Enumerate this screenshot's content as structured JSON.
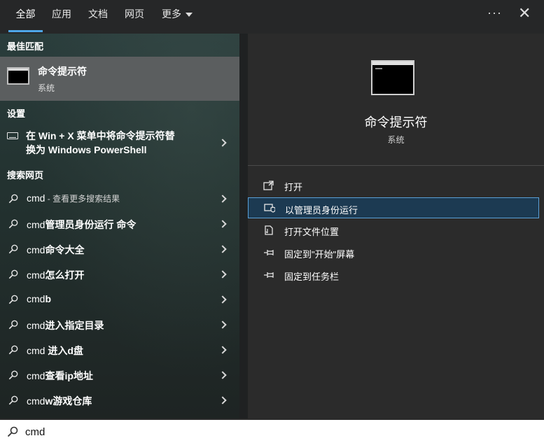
{
  "tabs": [
    {
      "label": "全部"
    },
    {
      "label": "应用"
    },
    {
      "label": "文档"
    },
    {
      "label": "网页"
    },
    {
      "label": "更多"
    }
  ],
  "top_actions": {
    "more": "···",
    "close": "✕"
  },
  "sections": {
    "best_match": "最佳匹配",
    "settings": "设置",
    "web": "搜索网页"
  },
  "best_match": {
    "title": "命令提示符",
    "subtitle": "系统",
    "icon": "cmd-icon"
  },
  "setting_item": {
    "line1": "在 Win + X 菜单中将命令提示符替",
    "line2": "换为 Windows PowerShell",
    "icon": "keyboard-icon"
  },
  "web_results": [
    {
      "query": "cmd",
      "suffix": " - 查看更多搜索结果",
      "bold": ""
    },
    {
      "query": "cmd",
      "suffix": "",
      "bold": "管理员身份运行 命令"
    },
    {
      "query": "cmd",
      "suffix": "",
      "bold": "命令大全"
    },
    {
      "query": "cmd",
      "suffix": "",
      "bold": "怎么打开"
    },
    {
      "query": "cmd",
      "suffix": "",
      "bold": "b"
    },
    {
      "query": "cmd",
      "suffix": "",
      "bold": "进入指定目录"
    },
    {
      "query": "cmd",
      "suffix": "",
      "bold": " 进入d盘"
    },
    {
      "query": "cmd",
      "suffix": "",
      "bold": "查看ip地址"
    },
    {
      "query": "cmd",
      "suffix": "",
      "bold": "w游戏仓库"
    }
  ],
  "detail": {
    "title": "命令提示符",
    "subtitle": "系统",
    "actions": [
      {
        "label": "打开",
        "icon": "open-icon"
      },
      {
        "label": "以管理员身份运行",
        "icon": "shield-icon"
      },
      {
        "label": "打开文件位置",
        "icon": "file-location-icon"
      },
      {
        "label": "固定到\"开始\"屏幕",
        "icon": "pin-icon"
      },
      {
        "label": "固定到任务栏",
        "icon": "pin-icon"
      }
    ]
  },
  "search": {
    "value": "cmd"
  },
  "colors": {
    "accent": "#4ea6e8",
    "selected_bg": "#1c3a52",
    "selected_border": "#5aa0d8"
  }
}
